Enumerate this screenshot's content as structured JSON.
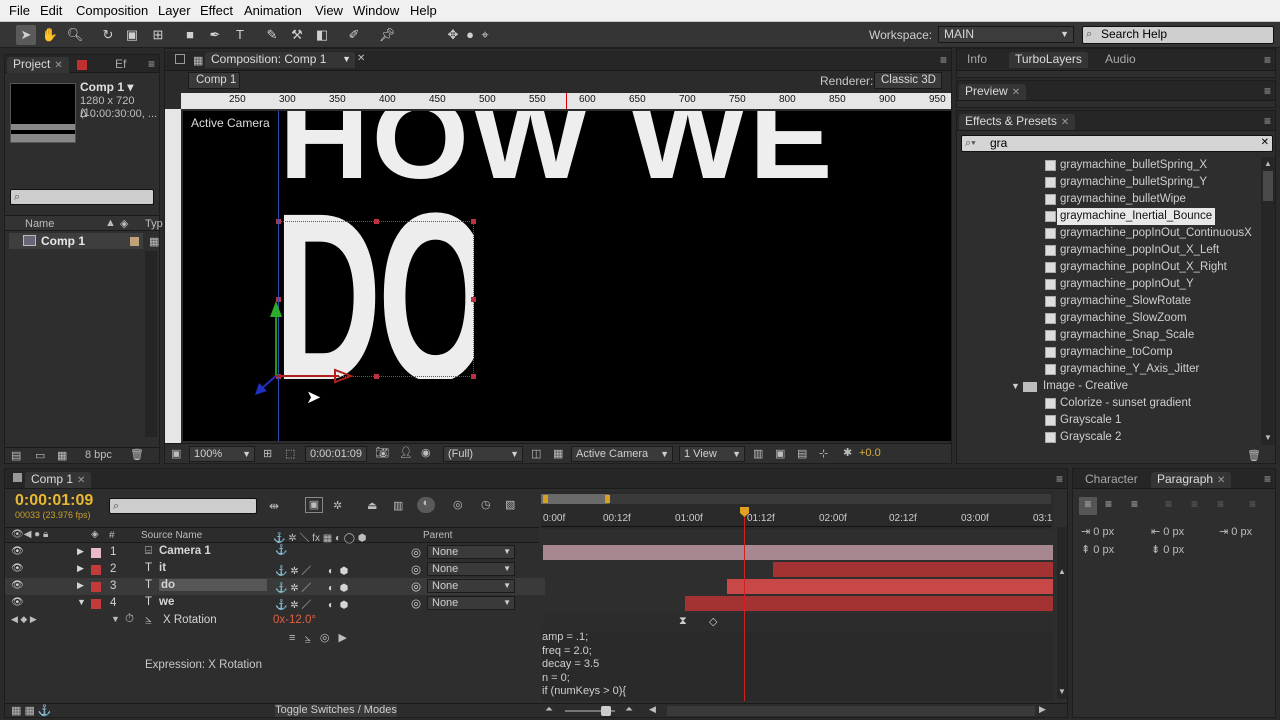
{
  "menu": [
    "File",
    "Edit",
    "Composition",
    "Layer",
    "Effect",
    "Animation",
    "View",
    "Window",
    "Help"
  ],
  "toolbar": {
    "workspace_label": "Workspace:",
    "workspace_value": "MAIN",
    "search_help": "Search Help"
  },
  "project": {
    "tab": "Project",
    "tab2": "Ef",
    "comp_name": "Comp 1 ▾",
    "comp_res": "1280 x 720 (1....",
    "comp_dur": "Δ 0:00:30:00, ...",
    "col_name": "Name",
    "col_type": "Typ",
    "item": "Comp 1",
    "bpc": "8 bpc"
  },
  "composition": {
    "tab": "Composition: Comp 1",
    "subtab": "Comp 1",
    "renderer_label": "Renderer:",
    "renderer": "Classic 3D",
    "camera_label": "Active Camera",
    "title_top": "HOW WE",
    "title_main": "DO",
    "ruler": [
      "250",
      "300",
      "350",
      "400",
      "450",
      "500",
      "550",
      "600",
      "650",
      "700",
      "750",
      "800",
      "850",
      "900",
      "950"
    ],
    "zoom": "100%",
    "timecode": "0:00:01:09",
    "quality": "(Full)",
    "view_camera": "Active Camera",
    "views": "1 View",
    "exposure": "+0.0"
  },
  "right_tabs": {
    "info": "Info",
    "turbolayers": "TurboLayers",
    "audio": "Audio",
    "preview": "Preview",
    "effects": "Effects & Presets",
    "search": "gra"
  },
  "effects_list": [
    {
      "label": "graymachine_bulletSpring_X",
      "type": "preset"
    },
    {
      "label": "graymachine_bulletSpring_Y",
      "type": "preset"
    },
    {
      "label": "graymachine_bulletWipe",
      "type": "preset"
    },
    {
      "label": "graymachine_Inertial_Bounce",
      "type": "preset",
      "selected": true
    },
    {
      "label": "graymachine_popInOut_ContinuousX",
      "type": "preset"
    },
    {
      "label": "graymachine_popInOut_X_Left",
      "type": "preset"
    },
    {
      "label": "graymachine_popInOut_X_Right",
      "type": "preset"
    },
    {
      "label": "graymachine_popInOut_Y",
      "type": "preset"
    },
    {
      "label": "graymachine_SlowRotate",
      "type": "preset"
    },
    {
      "label": "graymachine_SlowZoom",
      "type": "preset"
    },
    {
      "label": "graymachine_Snap_Scale",
      "type": "preset"
    },
    {
      "label": "graymachine_toComp",
      "type": "preset"
    },
    {
      "label": "graymachine_Y_Axis_Jitter",
      "type": "preset"
    },
    {
      "label": "Image - Creative",
      "type": "folder"
    },
    {
      "label": "Colorize - sunset gradient",
      "type": "preset"
    },
    {
      "label": "Grayscale 1",
      "type": "preset"
    },
    {
      "label": "Grayscale 2",
      "type": "preset"
    }
  ],
  "timeline": {
    "tab": "Comp 1",
    "timecode": "0:00:01:09",
    "fps": "00033 (23.976 fps)",
    "col_source": "Source Name",
    "col_parent": "Parent",
    "ruler": [
      "0:00f",
      "00:12f",
      "01:00f",
      "01:12f",
      "02:00f",
      "02:12f",
      "03:00f",
      "03:1"
    ],
    "toggle": "Toggle Switches / Modes",
    "layers": [
      {
        "num": "1",
        "name": "Camera 1",
        "parent": "None",
        "color": "#e8b9c8",
        "bar": "#a78890",
        "type": "camera"
      },
      {
        "num": "2",
        "name": "it",
        "parent": "None",
        "color": "#c23a3a",
        "bar": "#a53232",
        "type": "text"
      },
      {
        "num": "3",
        "name": "do",
        "parent": "None",
        "color": "#c23a3a",
        "bar": "#c84848",
        "type": "text",
        "selected": true
      },
      {
        "num": "4",
        "name": "we",
        "parent": "None",
        "color": "#c23a3a",
        "bar": "#a53232",
        "type": "text",
        "expanded": true
      }
    ],
    "property": {
      "name": "X Rotation",
      "value": "0x-12.0°"
    },
    "expression_label": "Expression: X Rotation",
    "expression": [
      "amp = .1;",
      "freq = 2.0;",
      "decay = 3.5",
      "n = 0;",
      "if (numKeys > 0){"
    ]
  },
  "paragraph": {
    "tab1": "Character",
    "tab2": "Paragraph",
    "px": "0 px"
  }
}
